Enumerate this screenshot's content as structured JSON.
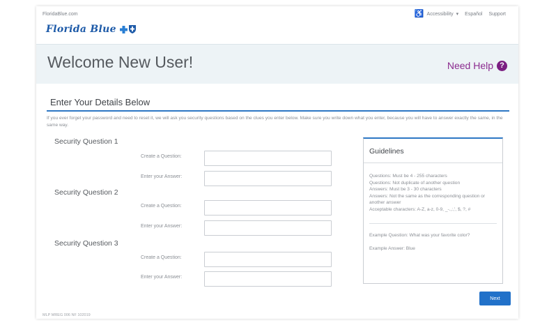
{
  "topbar": {
    "site": "FloridaBlue.com",
    "accessibility": "Accessibility",
    "accessibility_caret": "▾",
    "espanol": "Español",
    "support": "Support"
  },
  "brand": {
    "name": "Florida Blue",
    "color": "#1d5aa8"
  },
  "hero": {
    "title": "Welcome New User!",
    "help_label": "Need Help",
    "help_icon": "?"
  },
  "form": {
    "section_title": "Enter Your Details Below",
    "intro": "If you ever forget your password and need to reset it, we will ask you security questions based on the clues you enter below. Make sure you write down what you enter, because you will have to answer exactly the same, in the same way.",
    "questions": [
      {
        "title": "Security Question 1",
        "question_label": "Create a Question:",
        "answer_label": "Enter your Answer:",
        "question_value": "",
        "answer_value": ""
      },
      {
        "title": "Security Question 2",
        "question_label": "Create a Question:",
        "answer_label": "Enter your Answer:",
        "question_value": "",
        "answer_value": ""
      },
      {
        "title": "Security Question 3",
        "question_label": "Create a Question:",
        "answer_label": "Enter your Answer:",
        "question_value": "",
        "answer_value": ""
      }
    ],
    "next_label": "Next"
  },
  "guidelines": {
    "title": "Guidelines",
    "rules": "Questions: Must be 4 - 255 characters\nQuestions: Not duplicate of another question\nAnswers: Must be 3 - 30 characters\nAnswers: Not the same as the corresponding question or another answer\nAcceptable characters: A-Z, a-z, 0-9, _-.,:,', $, ?, #",
    "example_question": "Example Question: What was your favorite color?",
    "example_answer": "Example Answer: Blue"
  },
  "footer": {
    "code": "MLP MREG 006 NF 102019"
  },
  "colors": {
    "accent": "#2d77c4",
    "help": "#8b2b8f",
    "button": "#2171c9",
    "hero_bg": "#edf3f6"
  },
  "icons": {
    "accessibility": "accessibility-icon",
    "help": "question-circle-icon",
    "logo": "cross-shield-logo"
  }
}
